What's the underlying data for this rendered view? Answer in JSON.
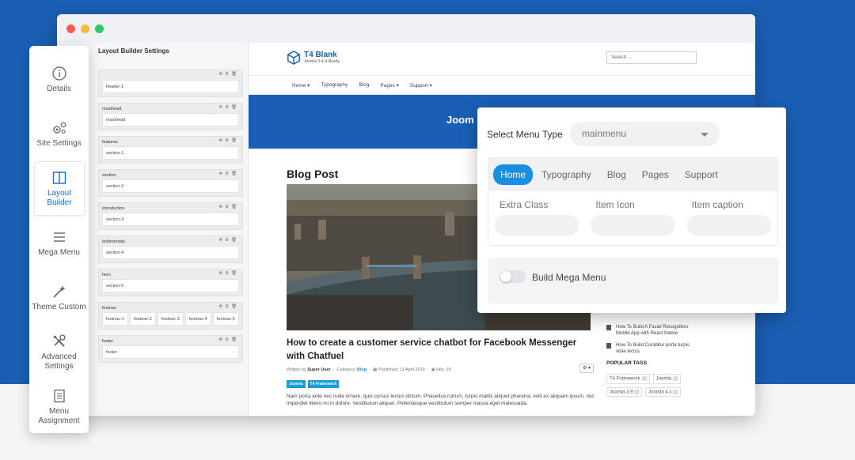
{
  "layout_builder": {
    "title": "Layout Builder Settings",
    "rows": [
      {
        "name": "",
        "cols": [
          "header-1"
        ]
      },
      {
        "name": "masthead",
        "cols": [
          "masthead"
        ]
      },
      {
        "name": "features",
        "cols": [
          "section-1"
        ]
      },
      {
        "name": "section",
        "cols": [
          "section-2"
        ]
      },
      {
        "name": "introduction",
        "cols": [
          "section-3"
        ]
      },
      {
        "name": "testimonials",
        "cols": [
          "section-4"
        ]
      },
      {
        "name": "hero",
        "cols": [
          "section-5"
        ]
      },
      {
        "name": "footnav",
        "cols": [
          "footnav-1",
          "footnav-2",
          "footnav-3",
          "footnav-4",
          "footnav-5"
        ]
      },
      {
        "name": "footer",
        "cols": [
          "footer"
        ]
      }
    ]
  },
  "site": {
    "logo_name": "T4 Blank",
    "logo_sub": "Joomla 3 & 4 Ready",
    "search_placeholder": "Search ...",
    "nav": [
      "Home ▾",
      "Typography",
      "Blog",
      "Pages ▾",
      "Support ▾"
    ],
    "hero_text": "Joom",
    "blog_title": "Blog Post",
    "post_title": "How to create a customer service chatbot for Facebook Messenger with Chatfuel",
    "meta": {
      "written_by_label": "Written by",
      "author": "Super User",
      "category_label": "Category:",
      "category": "Blog",
      "published": "Published: 11 April 2019",
      "hits": "Hits: 18"
    },
    "tags": [
      "Joomla",
      "T4 Framework"
    ],
    "excerpt": "Nam porta ante nec nulla ornare, quis cursus lectus dictum. Phasellus rutrum, turpis mattis aliquet pharetra, velit ex aliquam ipsum, nec imperdiet libero mi in dolore. Vestibulum aliquet. Pellentesque vestibulum semper massa eget malesuada."
  },
  "sidebar_right": {
    "items": [
      "How To Build A Facial Recognition Mobile App with React Native",
      "How To Build Curabitur porta turpis vitae lectus"
    ],
    "popular_tags_heading": "POPULAR TAGS",
    "popular_tags": [
      "T4 Framework",
      "Joomla",
      "Joomla 3.9",
      "Joomla 4.x"
    ]
  },
  "vnav": [
    {
      "label": "Details",
      "icon": "info-icon"
    },
    {
      "label": "Site Settings",
      "icon": "settings-gears-icon"
    },
    {
      "label": "Layout Builder",
      "icon": "layout-icon",
      "active": true
    },
    {
      "label": "Mega Menu",
      "icon": "menu-icon"
    },
    {
      "label": "Theme Custom",
      "icon": "magic-wand-icon"
    },
    {
      "label": "Advanced Settings",
      "icon": "tools-icon"
    },
    {
      "label": "Menu Assignment",
      "icon": "list-icon"
    }
  ],
  "popup": {
    "select_label": "Select Menu Type",
    "select_value": "mainmenu",
    "tabs": [
      "Home",
      "Typography",
      "Blog",
      "Pages",
      "Support"
    ],
    "fields": [
      "Extra Class",
      "Item Icon",
      "Item caption"
    ],
    "mega_label": "Build Mega Menu",
    "mega_enabled": false
  },
  "colors": {
    "brand_blue": "#1a5fb4",
    "active_tab": "#1a8fe0",
    "tag_blue": "#1a9cd8"
  }
}
